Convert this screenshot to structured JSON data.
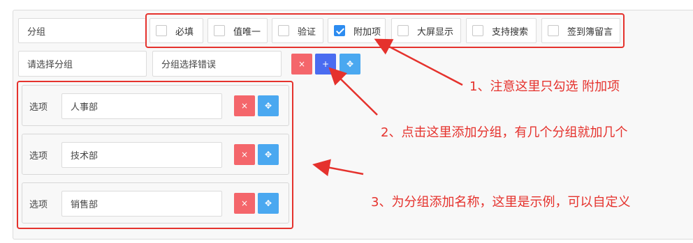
{
  "group_label": "分组",
  "group_select": "请选择分组",
  "group_error": "分组选择错误",
  "options": [
    {
      "label": "必填",
      "checked": false
    },
    {
      "label": "值唯一",
      "checked": false
    },
    {
      "label": "验证",
      "checked": false
    },
    {
      "label": "附加项",
      "checked": true
    },
    {
      "label": "大屏显示",
      "checked": false
    },
    {
      "label": "支持搜索",
      "checked": false
    },
    {
      "label": "签到簿留言",
      "checked": false
    }
  ],
  "buttons": {
    "delete": "×",
    "add": "+",
    "move": "✥"
  },
  "rows": [
    {
      "label": "选项",
      "value": "人事部"
    },
    {
      "label": "选项",
      "value": "技术部"
    },
    {
      "label": "选项",
      "value": "销售部"
    }
  ],
  "annotations": {
    "note1": "1、注意这里只勾选 附加项",
    "note2": "2、点击这里添加分组，有几个分组就加几个",
    "note3": "3、为分组添加名称，这里是示例，可以自定义"
  },
  "colors": {
    "accent": "#2d8cf0",
    "danger": "#f4666b",
    "annotation": "#e5322d"
  }
}
